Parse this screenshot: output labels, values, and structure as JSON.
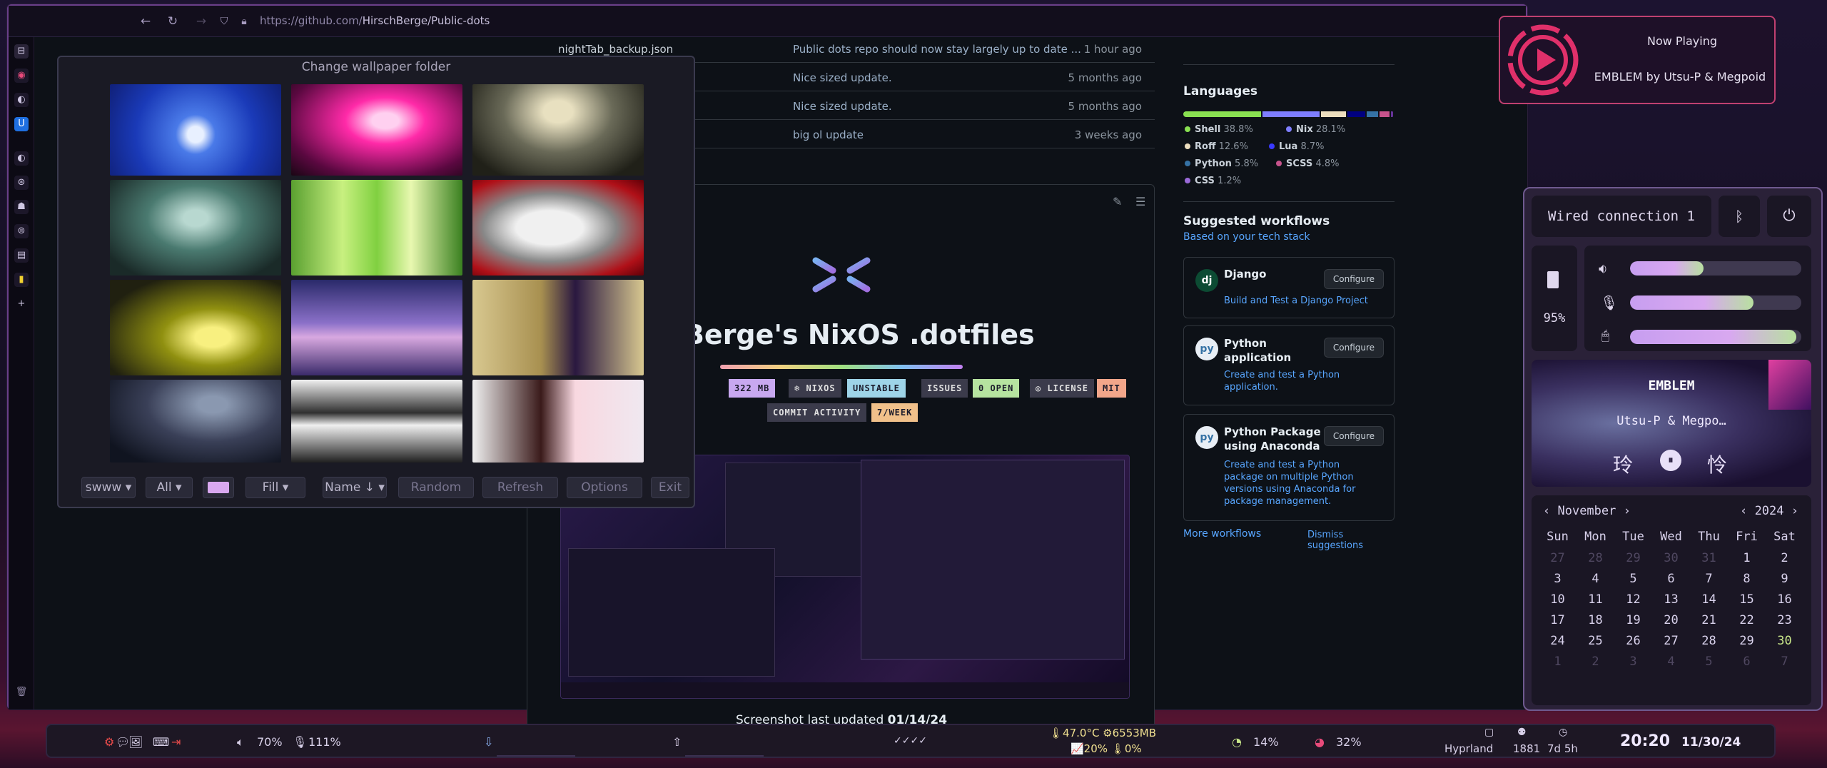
{
  "browser": {
    "url_prefix": "https://github.com/",
    "url_path": "HirschBerge/Public-dots"
  },
  "repo": {
    "rows": [
      {
        "file": "nightTab_backup.json",
        "msg": "Public dots repo should now stay largely up to date ...",
        "time": "1 hour ago"
      },
      {
        "file": "",
        "msg": "Nice sized update.",
        "time": "5 months ago"
      },
      {
        "file": "",
        "msg": "Nice sized update.",
        "time": "5 months ago"
      },
      {
        "file": "",
        "msg": "big ol update",
        "time": "3 weeks ago"
      }
    ],
    "readme_title": "chBerge's NixOS .dotfiles",
    "badges": [
      {
        "text": "322 MB",
        "bg": "#c8a8f0",
        "fg": "#1b1b2b"
      },
      {
        "text": "❄ NIXOS",
        "bg": "#3b3b4b",
        "fg": "#e0e0e0"
      },
      {
        "text": "UNSTABLE",
        "bg": "#9ed4e8",
        "fg": "#1b1b2b"
      },
      {
        "text": "ISSUES",
        "bg": "#3b3b4b",
        "fg": "#e0e0e0"
      },
      {
        "text": "0 OPEN",
        "bg": "#b6e3a0",
        "fg": "#1b1b2b"
      },
      {
        "text": "◎ LICENSE",
        "bg": "#3b3b4b",
        "fg": "#e0e0e0"
      },
      {
        "text": "MIT",
        "bg": "#f2a68a",
        "fg": "#1b1b2b"
      },
      {
        "text": "COMMIT ACTIVITY",
        "bg": "#3b3b4b",
        "fg": "#e0e0e0"
      },
      {
        "text": "7/WEEK",
        "bg": "#f0c08a",
        "fg": "#1b1b2b"
      }
    ],
    "caption_prefix": "Screenshot last updated ",
    "caption_date": "01/14/24"
  },
  "languages": {
    "heading": "Languages",
    "items": [
      {
        "name": "Shell",
        "pct": "38.8%",
        "color": "#89e051",
        "share": 38.8
      },
      {
        "name": "Nix",
        "pct": "28.1%",
        "color": "#7e7eff",
        "share": 28.1
      },
      {
        "name": "Roff",
        "pct": "12.6%",
        "color": "#ecdebe",
        "share": 12.6
      },
      {
        "name": "Lua",
        "pct": "8.7%",
        "color": "#000080",
        "share": 8.7
      },
      {
        "name": "Python",
        "pct": "5.8%",
        "color": "#3572A5",
        "share": 5.8
      },
      {
        "name": "SCSS",
        "pct": "4.8%",
        "color": "#c6538c",
        "share": 4.8
      },
      {
        "name": "CSS",
        "pct": "1.2%",
        "color": "#663399",
        "share": 1.2
      }
    ]
  },
  "workflows": {
    "heading": "Suggested workflows",
    "sub": "Based on your tech stack",
    "items": [
      {
        "name": "Django",
        "desc": "Build and Test a Django Project",
        "icon": "dj",
        "button": "Configure"
      },
      {
        "name": "Python application",
        "desc": "Create and test a Python application.",
        "icon": "py",
        "button": "Configure"
      },
      {
        "name": "Python Package using Anaconda",
        "desc": "Create and test a Python package on multiple Python versions using Anaconda for package management.",
        "icon": "py",
        "button": "Configure"
      }
    ],
    "more": "More workflows",
    "dismiss": "Dismiss suggestions"
  },
  "wallpaper": {
    "title": "Change wallpaper folder",
    "controls": [
      "swww",
      "All",
      "",
      "Fill",
      "Name ↓",
      "Random",
      "Refresh",
      "Options",
      "Exit"
    ],
    "swatch": "#d9a8f0"
  },
  "now_playing": {
    "label": "Now Playing",
    "track": "EMBLEM by Utsu-P & Megpoid",
    "accent": "#e0306a"
  },
  "panel": {
    "network": "Wired connection 1",
    "battery": "95%",
    "volume_level": 0.43,
    "mic_level": 0.72,
    "brightness_level": 0.97,
    "media_title": "EMBLEM",
    "media_artist": "Utsu-P & Megpo…",
    "media_prev": "玲",
    "media_next": "怜",
    "cal_month": "November",
    "cal_year": "2024",
    "weekdays": [
      "Sun",
      "Mon",
      "Tue",
      "Wed",
      "Thu",
      "Fri",
      "Sat"
    ],
    "days": [
      [
        "27",
        "28",
        "29",
        "30",
        "31",
        "1",
        "2"
      ],
      [
        "3",
        "4",
        "5",
        "6",
        "7",
        "8",
        "9"
      ],
      [
        "10",
        "11",
        "12",
        "13",
        "14",
        "15",
        "16"
      ],
      [
        "17",
        "18",
        "19",
        "20",
        "21",
        "22",
        "23"
      ],
      [
        "24",
        "25",
        "26",
        "27",
        "28",
        "29",
        "30"
      ],
      [
        "1",
        "2",
        "3",
        "4",
        "5",
        "6",
        "7"
      ]
    ]
  },
  "taskbar": {
    "volume": "70%",
    "mic": "111%",
    "checks": "✓✓✓✓",
    "temp_mem": "🌡47.0°C ⚙6553MB",
    "cpu": "📈20% 🌡0%",
    "stat1": "14%",
    "stat2": "32%",
    "wm": "Hyprland",
    "uptime_a": "1881",
    "uptime_b": "7d 5h",
    "clock": "20:20",
    "date": "11/30/24"
  }
}
